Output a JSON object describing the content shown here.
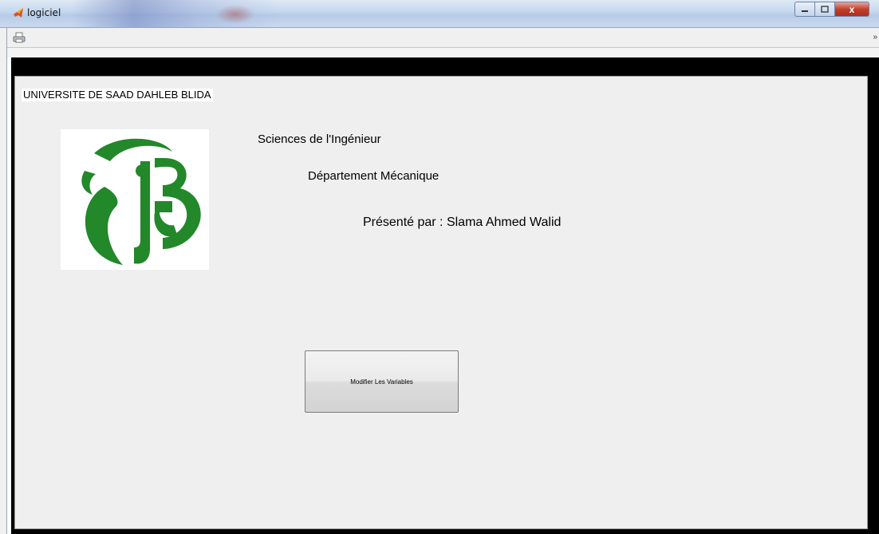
{
  "window": {
    "title": "logiciel",
    "close_glyph": "x"
  },
  "icons": {
    "app": "matlab-icon",
    "print": "print-icon",
    "toolbar_overflow": "chevron-right-icon"
  },
  "colors": {
    "logo_green": "#22882a",
    "panel_background": "#efefef",
    "figure_background": "#000000"
  },
  "panel": {
    "title": "UNIVERSITE DE SAAD DAHLEB BLIDA",
    "faculty": "Sciences de l'Ingénieur",
    "department": "Département Mécanique",
    "presenter": "Présenté par : Slama Ahmed Walid",
    "button_label": "Modifier Les Variables"
  }
}
